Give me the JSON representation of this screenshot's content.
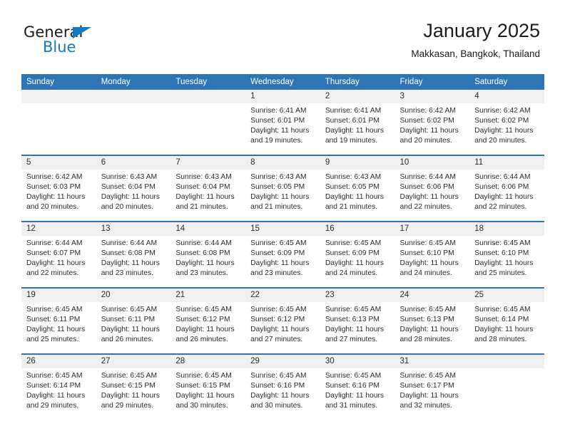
{
  "brand": {
    "name_top": "General",
    "name_bottom": "Blue",
    "accent_color": "#1479bf"
  },
  "header": {
    "title": "January 2025",
    "subtitle": "Makkasan, Bangkok, Thailand"
  },
  "theme": {
    "header_bg": "#2e75b6",
    "daynum_bg": "#f0f0f0",
    "text": "#2b2b2b"
  },
  "weekday_headers": [
    "Sunday",
    "Monday",
    "Tuesday",
    "Wednesday",
    "Thursday",
    "Friday",
    "Saturday"
  ],
  "labels": {
    "sunrise_prefix": "Sunrise:",
    "sunset_prefix": "Sunset:",
    "daylight_prefix": "Daylight:"
  },
  "weeks": [
    [
      {
        "day": "",
        "empty": true
      },
      {
        "day": "",
        "empty": true
      },
      {
        "day": "",
        "empty": true
      },
      {
        "day": "1",
        "sunrise": "Sunrise: 6:41 AM",
        "sunset": "Sunset: 6:01 PM",
        "daylight": "Daylight: 11 hours and 19 minutes."
      },
      {
        "day": "2",
        "sunrise": "Sunrise: 6:41 AM",
        "sunset": "Sunset: 6:01 PM",
        "daylight": "Daylight: 11 hours and 19 minutes."
      },
      {
        "day": "3",
        "sunrise": "Sunrise: 6:42 AM",
        "sunset": "Sunset: 6:02 PM",
        "daylight": "Daylight: 11 hours and 20 minutes."
      },
      {
        "day": "4",
        "sunrise": "Sunrise: 6:42 AM",
        "sunset": "Sunset: 6:02 PM",
        "daylight": "Daylight: 11 hours and 20 minutes."
      }
    ],
    [
      {
        "day": "5",
        "sunrise": "Sunrise: 6:42 AM",
        "sunset": "Sunset: 6:03 PM",
        "daylight": "Daylight: 11 hours and 20 minutes."
      },
      {
        "day": "6",
        "sunrise": "Sunrise: 6:43 AM",
        "sunset": "Sunset: 6:04 PM",
        "daylight": "Daylight: 11 hours and 20 minutes."
      },
      {
        "day": "7",
        "sunrise": "Sunrise: 6:43 AM",
        "sunset": "Sunset: 6:04 PM",
        "daylight": "Daylight: 11 hours and 21 minutes."
      },
      {
        "day": "8",
        "sunrise": "Sunrise: 6:43 AM",
        "sunset": "Sunset: 6:05 PM",
        "daylight": "Daylight: 11 hours and 21 minutes."
      },
      {
        "day": "9",
        "sunrise": "Sunrise: 6:43 AM",
        "sunset": "Sunset: 6:05 PM",
        "daylight": "Daylight: 11 hours and 21 minutes."
      },
      {
        "day": "10",
        "sunrise": "Sunrise: 6:44 AM",
        "sunset": "Sunset: 6:06 PM",
        "daylight": "Daylight: 11 hours and 22 minutes."
      },
      {
        "day": "11",
        "sunrise": "Sunrise: 6:44 AM",
        "sunset": "Sunset: 6:06 PM",
        "daylight": "Daylight: 11 hours and 22 minutes."
      }
    ],
    [
      {
        "day": "12",
        "sunrise": "Sunrise: 6:44 AM",
        "sunset": "Sunset: 6:07 PM",
        "daylight": "Daylight: 11 hours and 22 minutes."
      },
      {
        "day": "13",
        "sunrise": "Sunrise: 6:44 AM",
        "sunset": "Sunset: 6:08 PM",
        "daylight": "Daylight: 11 hours and 23 minutes."
      },
      {
        "day": "14",
        "sunrise": "Sunrise: 6:44 AM",
        "sunset": "Sunset: 6:08 PM",
        "daylight": "Daylight: 11 hours and 23 minutes."
      },
      {
        "day": "15",
        "sunrise": "Sunrise: 6:45 AM",
        "sunset": "Sunset: 6:09 PM",
        "daylight": "Daylight: 11 hours and 23 minutes."
      },
      {
        "day": "16",
        "sunrise": "Sunrise: 6:45 AM",
        "sunset": "Sunset: 6:09 PM",
        "daylight": "Daylight: 11 hours and 24 minutes."
      },
      {
        "day": "17",
        "sunrise": "Sunrise: 6:45 AM",
        "sunset": "Sunset: 6:10 PM",
        "daylight": "Daylight: 11 hours and 24 minutes."
      },
      {
        "day": "18",
        "sunrise": "Sunrise: 6:45 AM",
        "sunset": "Sunset: 6:10 PM",
        "daylight": "Daylight: 11 hours and 25 minutes."
      }
    ],
    [
      {
        "day": "19",
        "sunrise": "Sunrise: 6:45 AM",
        "sunset": "Sunset: 6:11 PM",
        "daylight": "Daylight: 11 hours and 25 minutes."
      },
      {
        "day": "20",
        "sunrise": "Sunrise: 6:45 AM",
        "sunset": "Sunset: 6:11 PM",
        "daylight": "Daylight: 11 hours and 26 minutes."
      },
      {
        "day": "21",
        "sunrise": "Sunrise: 6:45 AM",
        "sunset": "Sunset: 6:12 PM",
        "daylight": "Daylight: 11 hours and 26 minutes."
      },
      {
        "day": "22",
        "sunrise": "Sunrise: 6:45 AM",
        "sunset": "Sunset: 6:12 PM",
        "daylight": "Daylight: 11 hours and 27 minutes."
      },
      {
        "day": "23",
        "sunrise": "Sunrise: 6:45 AM",
        "sunset": "Sunset: 6:13 PM",
        "daylight": "Daylight: 11 hours and 27 minutes."
      },
      {
        "day": "24",
        "sunrise": "Sunrise: 6:45 AM",
        "sunset": "Sunset: 6:13 PM",
        "daylight": "Daylight: 11 hours and 28 minutes."
      },
      {
        "day": "25",
        "sunrise": "Sunrise: 6:45 AM",
        "sunset": "Sunset: 6:14 PM",
        "daylight": "Daylight: 11 hours and 28 minutes."
      }
    ],
    [
      {
        "day": "26",
        "sunrise": "Sunrise: 6:45 AM",
        "sunset": "Sunset: 6:14 PM",
        "daylight": "Daylight: 11 hours and 29 minutes."
      },
      {
        "day": "27",
        "sunrise": "Sunrise: 6:45 AM",
        "sunset": "Sunset: 6:15 PM",
        "daylight": "Daylight: 11 hours and 29 minutes."
      },
      {
        "day": "28",
        "sunrise": "Sunrise: 6:45 AM",
        "sunset": "Sunset: 6:15 PM",
        "daylight": "Daylight: 11 hours and 30 minutes."
      },
      {
        "day": "29",
        "sunrise": "Sunrise: 6:45 AM",
        "sunset": "Sunset: 6:16 PM",
        "daylight": "Daylight: 11 hours and 30 minutes."
      },
      {
        "day": "30",
        "sunrise": "Sunrise: 6:45 AM",
        "sunset": "Sunset: 6:16 PM",
        "daylight": "Daylight: 11 hours and 31 minutes."
      },
      {
        "day": "31",
        "sunrise": "Sunrise: 6:45 AM",
        "sunset": "Sunset: 6:17 PM",
        "daylight": "Daylight: 11 hours and 32 minutes."
      },
      {
        "day": "",
        "empty": true
      }
    ]
  ]
}
